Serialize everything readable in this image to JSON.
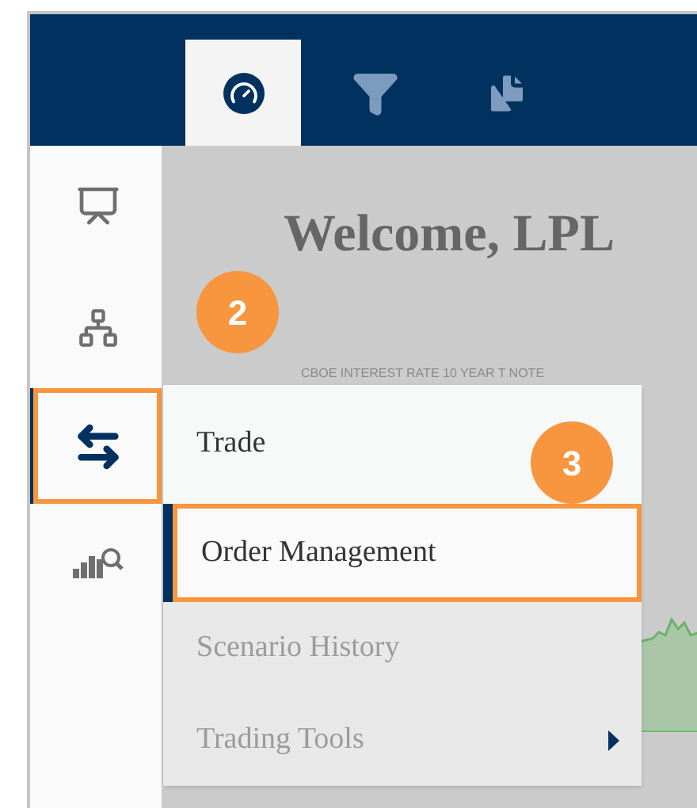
{
  "header_tabs": [
    {
      "kind": "gauge",
      "selected": true
    },
    {
      "kind": "filter",
      "selected": false
    },
    {
      "kind": "documents",
      "selected": false
    }
  ],
  "sidebar": {
    "items": [
      {
        "kind": "presentation",
        "selected": false,
        "highlighted": false
      },
      {
        "kind": "org-chart",
        "selected": false,
        "highlighted": false
      },
      {
        "kind": "swap",
        "selected": true,
        "highlighted": true
      },
      {
        "kind": "analytics",
        "selected": false,
        "highlighted": false
      }
    ]
  },
  "content": {
    "heading": "Welcome, LPL",
    "chart_title": "CBOE INTEREST RATE 10 YEAR T NOTE"
  },
  "menu": {
    "items": [
      {
        "label": "Trade",
        "selected": false,
        "disabled": false,
        "submenu": false,
        "highlighted": false
      },
      {
        "label": "Order Management",
        "selected": true,
        "disabled": false,
        "submenu": false,
        "highlighted": true
      },
      {
        "label": "Scenario History",
        "selected": false,
        "disabled": true,
        "submenu": false,
        "highlighted": false
      },
      {
        "label": "Trading Tools",
        "selected": false,
        "disabled": true,
        "submenu": true,
        "highlighted": false
      }
    ]
  },
  "callouts": [
    {
      "label": "2"
    },
    {
      "label": "3"
    }
  ]
}
